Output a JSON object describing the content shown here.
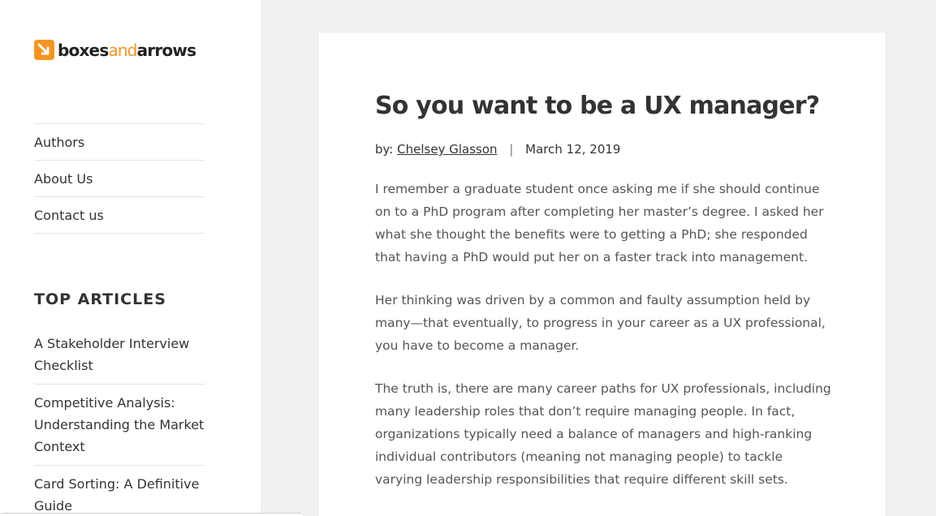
{
  "logo": {
    "part1": "boxes",
    "part2": "and",
    "part3": "arrows"
  },
  "nav": [
    {
      "label": "Authors"
    },
    {
      "label": "About Us"
    },
    {
      "label": "Contact us"
    }
  ],
  "top_articles": {
    "title": "TOP ARTICLES",
    "items": [
      "A Stakeholder Interview Checklist",
      "Competitive Analysis: Understanding the Market Context",
      "Card Sorting: A Definitive Guide"
    ]
  },
  "post": {
    "title": "So you want to be a UX manager?",
    "by_label": "by:",
    "author": "Chelsey Glasson",
    "separator": "|",
    "date": "March 12, 2019",
    "paragraphs": [
      "I remember a graduate student once asking me if she should continue on to a PhD program after completing her master’s degree. I asked her what she thought the benefits were to getting a PhD; she responded that having a PhD would put her on a faster track into management.",
      "Her thinking was driven by a common and faulty assumption held by many—that eventually, to progress in your career as a UX professional, you have to become a manager.",
      "The truth is, there are many career paths for UX professionals, including many leadership roles that don’t require managing people. In fact, organizations typically need a balance of managers and high-ranking individual contributors (meaning not managing people) to tackle varying leadership responsibilities that require different skill sets."
    ]
  },
  "colors": {
    "accent": "#f7941d",
    "background": "#f1f1f1"
  }
}
